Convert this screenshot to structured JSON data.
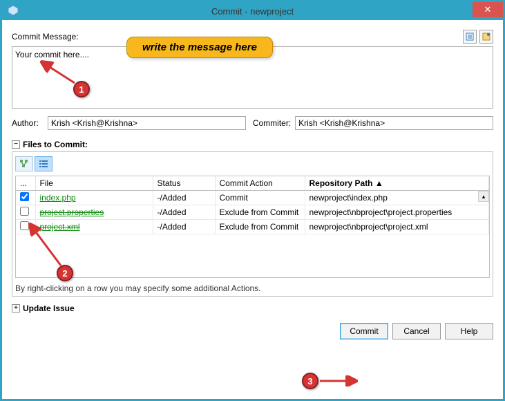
{
  "window": {
    "title": "Commit - newproject"
  },
  "labels": {
    "commit_msg": "Commit Message:",
    "author": "Author:",
    "commiter": "Commiter:",
    "files_to_commit": "Files to Commit:",
    "update_issue": "Update Issue"
  },
  "commit_message": "Your commit here....",
  "author_value": "Krish <Krish@Krishna>",
  "commiter_value": "Krish <Krish@Krishna>",
  "columns": {
    "chk": "...",
    "file": "File",
    "status": "Status",
    "action": "Commit Action",
    "repo": "Repository Path"
  },
  "sort_indicator": "▲",
  "files": [
    {
      "checked": true,
      "name": "index.php",
      "status": "-/Added",
      "action": "Commit",
      "repo": "newproject\\index.php",
      "excluded": false
    },
    {
      "checked": false,
      "name": "project.properties",
      "status": "-/Added",
      "action": "Exclude from Commit",
      "repo": "newproject\\nbproject\\project.properties",
      "excluded": true
    },
    {
      "checked": false,
      "name": "project.xml",
      "status": "-/Added",
      "action": "Exclude from Commit",
      "repo": "newproject\\nbproject\\project.xml",
      "excluded": true
    }
  ],
  "hint": "By right-clicking on a row you may specify some additional Actions.",
  "buttons": {
    "commit": "Commit",
    "cancel": "Cancel",
    "help": "Help"
  },
  "annotations": {
    "callout": "write the message here",
    "b1": "1",
    "b2": "2",
    "b3": "3"
  }
}
